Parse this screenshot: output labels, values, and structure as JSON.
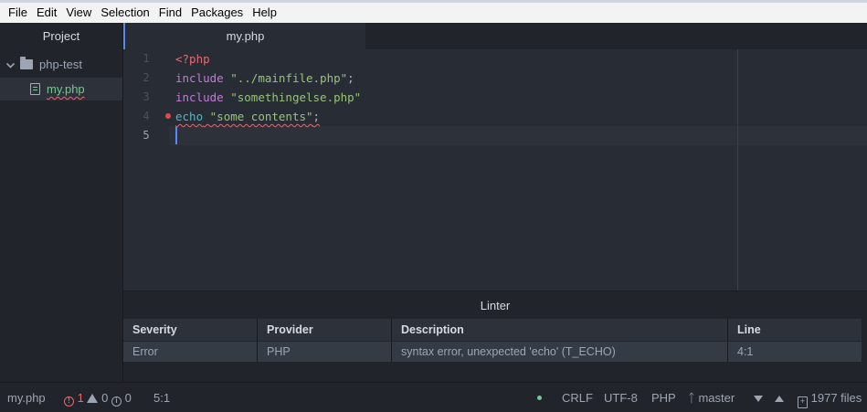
{
  "menubar": {
    "items": [
      "File",
      "Edit",
      "View",
      "Selection",
      "Find",
      "Packages",
      "Help"
    ]
  },
  "tree": {
    "tab_label": "Project",
    "project_name": "php-test",
    "files": [
      {
        "name": "my.php",
        "status": "modified"
      }
    ]
  },
  "editor": {
    "tab_label": "my.php",
    "line_numbers": [
      "1",
      "2",
      "3",
      "4",
      "5"
    ],
    "lines": [
      {
        "tokens": [
          {
            "t": "<?php",
            "c": "tag"
          }
        ]
      },
      {
        "tokens": [
          {
            "t": "include",
            "c": "kw"
          },
          {
            "t": " ",
            "c": "plain"
          },
          {
            "t": "\"../mainfile.php\"",
            "c": "str"
          },
          {
            "t": ";",
            "c": "plain"
          }
        ]
      },
      {
        "tokens": [
          {
            "t": "include",
            "c": "kw"
          },
          {
            "t": " ",
            "c": "plain"
          },
          {
            "t": "\"somethingelse.php\"",
            "c": "str"
          }
        ]
      },
      {
        "tokens": [
          {
            "t": "echo",
            "c": "echo"
          },
          {
            "t": " ",
            "c": "plain"
          },
          {
            "t": "\"some contents\"",
            "c": "str"
          },
          {
            "t": ";",
            "c": "plain"
          }
        ]
      },
      {
        "tokens": []
      }
    ],
    "error_line": 4,
    "cursor_line": 5
  },
  "linter": {
    "title": "Linter",
    "columns": [
      "Severity",
      "Provider",
      "Description",
      "Line"
    ],
    "rows": [
      {
        "severity": "Error",
        "provider": "PHP",
        "description": "syntax error, unexpected 'echo' (T_ECHO)",
        "line": "4:1"
      }
    ]
  },
  "statusbar": {
    "file": "my.php",
    "errors": "1",
    "warnings": "0",
    "infos": "0",
    "cursor": "5:1",
    "line_ending": "CRLF",
    "encoding": "UTF-8",
    "grammar": "PHP",
    "branch": "master",
    "files_count": "1977 files"
  },
  "colors": {
    "accent": "#568af2",
    "modified_green": "#73c990",
    "error_red": "#e06c75"
  }
}
